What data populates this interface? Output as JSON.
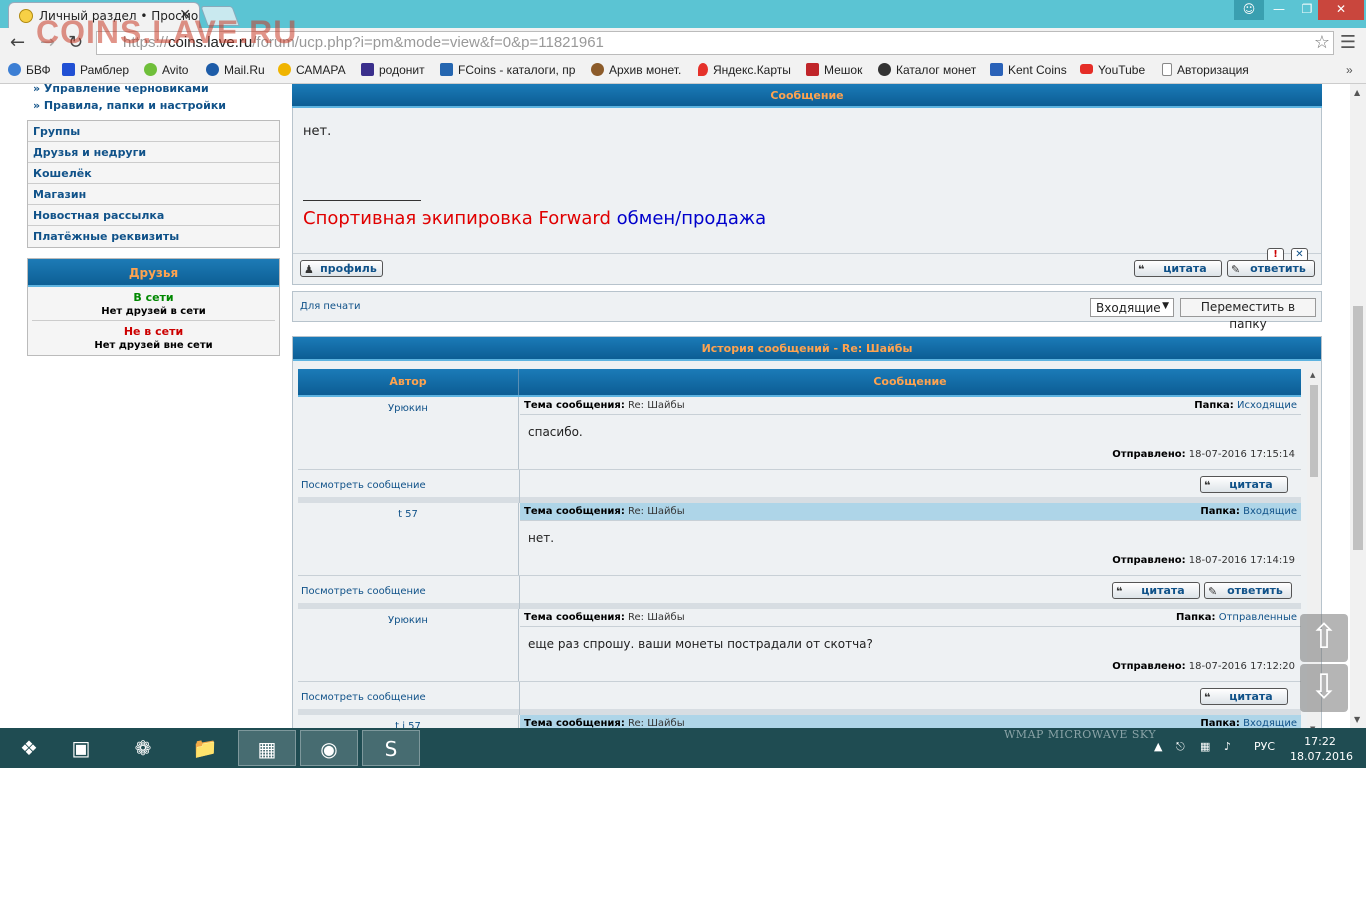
{
  "browser": {
    "tab_title": "Личный раздел • Просмо",
    "url_prefix": "https://",
    "url_host": "coins.lave.ru",
    "url_path": "/forum/ucp.php?i=pm&mode=view&f=0&p=11821961",
    "watermark": "COINS.LAVE.RU"
  },
  "bookmarks": [
    {
      "label": "БВФ",
      "icon": "chat-icon",
      "color": "#3d7fd4"
    },
    {
      "label": "Рамблер",
      "icon": "rambler-icon",
      "color": "#2150d4"
    },
    {
      "label": "Avito",
      "icon": "avito-icon",
      "color": "#6fbf3a"
    },
    {
      "label": "Mail.Ru",
      "icon": "mail-at-icon",
      "color": "#1d5ca8"
    },
    {
      "label": "САМАРА",
      "icon": "smiley-icon",
      "color": "#f0b400"
    },
    {
      "label": "родонит",
      "icon": "rodonit-icon",
      "color": "#3a2f8c"
    },
    {
      "label": "FCoins - каталоги, пр",
      "icon": "fc-icon",
      "color": "#2566b0"
    },
    {
      "label": "Архив монет.",
      "icon": "coin-icon",
      "color": "#8c5b2a"
    },
    {
      "label": "Яндекс.Карты",
      "icon": "map-pin-icon",
      "color": "#e5312a"
    },
    {
      "label": "Мешок",
      "icon": "bag-icon",
      "color": "#c0252a"
    },
    {
      "label": "Каталог монет",
      "icon": "catalog-icon",
      "color": "#333333"
    },
    {
      "label": "Kent Coins",
      "icon": "cart-icon",
      "color": "#2a62b8"
    },
    {
      "label": "YouTube",
      "icon": "youtube-icon",
      "color": "#e52d27"
    },
    {
      "label": "Авторизация",
      "icon": "page-icon",
      "color": "#888888"
    }
  ],
  "sidebar": {
    "sub_links": [
      "» Управление черновиками",
      "» Правила, папки и настройки"
    ],
    "menu": [
      "Группы",
      "Друзья и недруги",
      "Кошелёк",
      "Магазин",
      "Новостная рассылка",
      "Платёжные реквизиты"
    ],
    "friends": {
      "title": "Друзья",
      "online_label": "В сети",
      "online_none": "Нет друзей в сети",
      "offline_label": "Не в сети",
      "offline_none": "Нет друзей вне сети"
    }
  },
  "message": {
    "header": "Сообщение",
    "text": "нет.",
    "sig_red": "Спортивная экипировка Forward",
    "sig_blue": "обмен/продажа",
    "report_icon": "!",
    "delete_icon": "✕",
    "profile_btn": "профиль",
    "quote_btn": "цитата",
    "reply_btn": "ответить"
  },
  "actions": {
    "print_link": "Для печати",
    "folder_select": "Входящие",
    "move_btn": "Переместить в папку"
  },
  "history": {
    "title": "История сообщений - Re: Шайбы",
    "col_author": "Автор",
    "col_message": "Сообщение",
    "subject_label": "Тема сообщения:",
    "folder_label": "Папка:",
    "sent_label": "Отправлено:",
    "view_link": "Посмотреть сообщение",
    "quote_btn": "цитата",
    "reply_btn": "ответить",
    "entries": [
      {
        "author": "Урюкин",
        "subject": "Re: Шайбы",
        "folder": "Исходящие",
        "text": "спасибо.",
        "date": "18-07-2016 17:15:14",
        "highlight": false,
        "reply": false
      },
      {
        "author": "t      57",
        "subject": "Re: Шайбы",
        "folder": "Входящие",
        "text": "нет.",
        "date": "18-07-2016 17:14:19",
        "highlight": true,
        "reply": true
      },
      {
        "author": "Урюкин",
        "subject": "Re: Шайбы",
        "folder": "Отправленные",
        "text": "еще раз спрошу. ваши монеты пострадали от скотча?",
        "date": "18-07-2016 17:12:20",
        "highlight": false,
        "reply": false
      },
      {
        "author": "t  i 57",
        "subject": "Re: Шайбы",
        "folder": "Входящие",
        "text": "",
        "date": "",
        "highlight": true,
        "reply": true
      }
    ]
  },
  "taskbar": {
    "wallpaper_text": "WMAP MICROWAVE SKY",
    "lang": "РУС",
    "time": "17:22",
    "date": "18.07.2016"
  }
}
